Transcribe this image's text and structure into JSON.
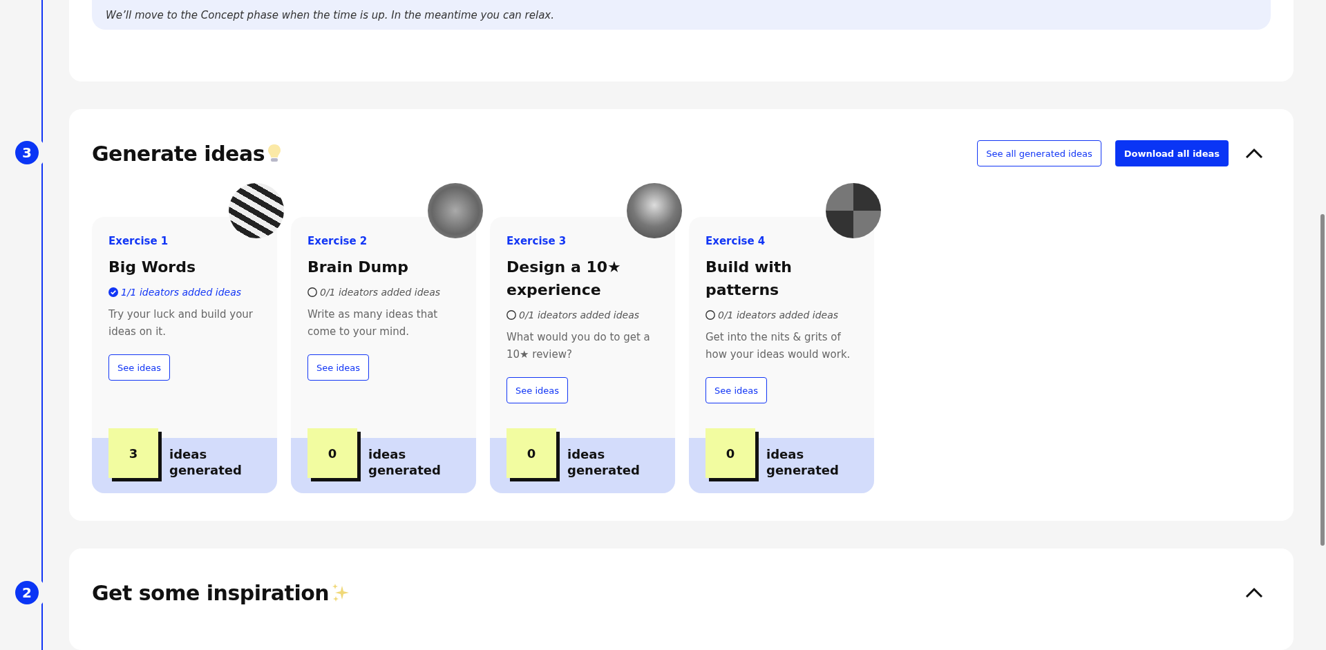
{
  "previous_section": {
    "notice": "We’ll move to the Concept phase when the time is up. In the meantime you can relax."
  },
  "sections": [
    {
      "kind": "exercises",
      "step": "3",
      "title": "Generate ideas",
      "expanded": true,
      "actions": [
        "See all generated ideas",
        "Download all ideas"
      ],
      "exercises": [
        {
          "label": "Exercise 1",
          "title": "Big Words",
          "done": true,
          "status": "1/1 ideators added ideas",
          "description": "Try your luck and build your ideas on it.",
          "button": "See ideas",
          "count": "3",
          "count_label": "ideas generated"
        },
        {
          "label": "Exercise 2",
          "title": "Brain Dump",
          "done": false,
          "status": "0/1 ideators added ideas",
          "description": "Write as many ideas that come to your mind.",
          "button": "See ideas",
          "count": "0",
          "count_label": "ideas generated"
        },
        {
          "label": "Exercise 3",
          "title": "Design a 10★ experience",
          "done": false,
          "status": "0/1 ideators added ideas",
          "description": "What would you do to get a 10★ review?",
          "button": "See ideas",
          "count": "0",
          "count_label": "ideas generated"
        },
        {
          "label": "Exercise 4",
          "title": "Build with patterns",
          "done": false,
          "status": "0/1 ideators added ideas",
          "description": "Get into the nits & grits of how your ideas would work.",
          "button": "See ideas",
          "count": "0",
          "count_label": "ideas generated"
        }
      ]
    },
    {
      "kind": "inspiration",
      "step": "2",
      "title": "Get some inspiration",
      "expanded": true
    }
  ]
}
